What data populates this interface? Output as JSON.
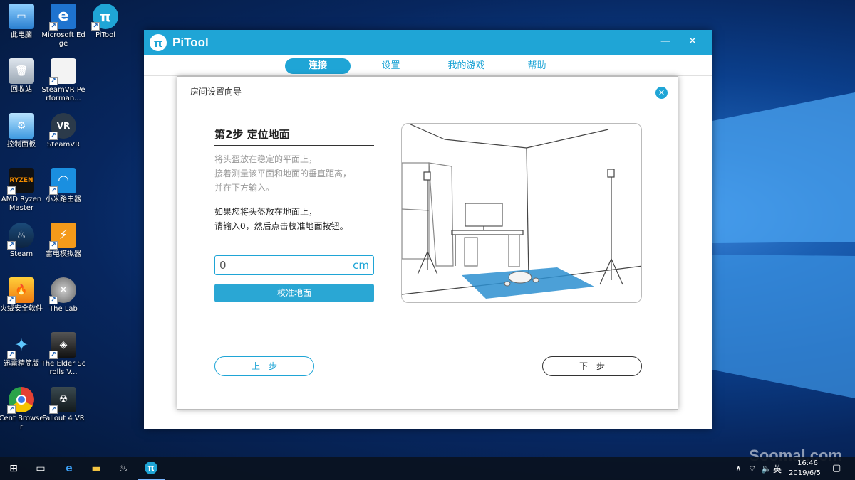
{
  "desktop": {
    "icons": [
      {
        "label": "此电脑"
      },
      {
        "label": "Microsoft Edge"
      },
      {
        "label": "PiTool"
      },
      {
        "label": "回收站"
      },
      {
        "label": "SteamVR Performan..."
      },
      {
        "label": "控制面板"
      },
      {
        "label": "SteamVR"
      },
      {
        "label": "AMD Ryzen Master"
      },
      {
        "label": "小米路由器"
      },
      {
        "label": "Steam"
      },
      {
        "label": "雷电模拟器"
      },
      {
        "label": "火绒安全软件"
      },
      {
        "label": "The Lab"
      },
      {
        "label": "迅雷精简版"
      },
      {
        "label": "The Elder Scrolls V..."
      },
      {
        "label": "Cent Browser"
      },
      {
        "label": "Fallout 4 VR"
      }
    ]
  },
  "window": {
    "title": "PiTool",
    "tabs": [
      {
        "label": "连接"
      },
      {
        "label": "设置"
      },
      {
        "label": "我的游戏"
      },
      {
        "label": "帮助"
      }
    ]
  },
  "dialog": {
    "title": "房间设置向导",
    "step_title": "第2步 定位地面",
    "desc_grey": [
      "将头盔放在稳定的平面上，",
      "接着测量该平面和地面的垂直距离，",
      "并在下方输入。"
    ],
    "desc_dark": [
      "如果您将头盔放在地面上，",
      "请输入0，然后点击校准地面按钮。"
    ],
    "input_value": "0",
    "unit": "cm",
    "calibrate_button": "校准地面",
    "prev_button": "上一步",
    "next_button": "下一步"
  },
  "taskbar": {
    "ime": "英",
    "time": "16:46",
    "date": "2019/6/5"
  },
  "watermark": "Soomal.com",
  "colors": {
    "accent": "#1fa5d6"
  }
}
